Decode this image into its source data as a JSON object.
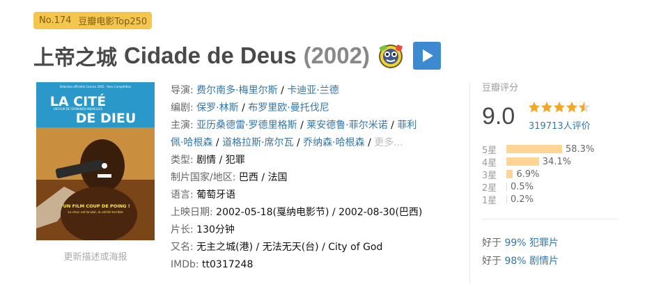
{
  "rank_badge": {
    "number": "No.174",
    "list": "豆瓣电影Top250"
  },
  "title": {
    "chinese": "上帝之城",
    "original": "Cidade de Deus",
    "year": "(2002)"
  },
  "icons": {
    "badge": "ticket-coin-icon",
    "play": "play-icon"
  },
  "poster": {
    "update_link": "更新描述或海报",
    "top_text": "Sélection officielle Cannes 2002 · Hors Compétition",
    "title_line1": "LA CITÉ",
    "title_line2": "DE DIEU",
    "director_line": "UN FILM DE FERNANDO MEIRELLES",
    "bottom_line1": "\"UN FILM COUP DE POING !",
    "bottom_line2": "Le choc est brutal, la vérité terrible"
  },
  "info": {
    "director": {
      "label": "导演:",
      "values": [
        "费尔南多·梅里尔斯",
        "卡迪亚·兰德"
      ]
    },
    "writer": {
      "label": "编剧:",
      "values": [
        "保罗·林斯",
        "布罗里欧·曼托伐尼"
      ]
    },
    "cast": {
      "label": "主演:",
      "line1": [
        "亚历桑德雷·罗德里格斯",
        "莱安德鲁·菲尔米诺",
        "菲利"
      ],
      "line2": [
        "佩·哈根森",
        "道格拉斯·席尔瓦",
        "乔纳森·哈根森"
      ],
      "more": "更多..."
    },
    "genre": {
      "label": "类型:",
      "values": [
        "剧情",
        "犯罪"
      ]
    },
    "region": {
      "label": "制片国家/地区:",
      "value": "巴西 / 法国"
    },
    "language": {
      "label": "语言:",
      "value": "葡萄牙语"
    },
    "release": {
      "label": "上映日期:",
      "values": [
        "2002-05-18(戛纳电影节)",
        "2002-08-30(巴西)"
      ]
    },
    "runtime": {
      "label": "片长:",
      "value": "130分钟"
    },
    "aka": {
      "label": "又名:",
      "value": "无主之城(港) / 无法无天(台) / City of God"
    },
    "imdb": {
      "label": "IMDb:",
      "value": "tt0317248"
    }
  },
  "rating": {
    "label": "豆瓣评分",
    "score": "9.0",
    "stars": 4.5,
    "votes": "319713人评价",
    "distribution": [
      {
        "star": "5星",
        "percent": "58.3%",
        "value": 58.3
      },
      {
        "star": "4星",
        "percent": "34.1%",
        "value": 34.1
      },
      {
        "star": "3星",
        "percent": "6.9%",
        "value": 6.9
      },
      {
        "star": "2星",
        "percent": "0.5%",
        "value": 0.5
      },
      {
        "star": "1星",
        "percent": "0.2%",
        "value": 0.2
      }
    ],
    "better_than": [
      {
        "prefix": "好于",
        "percent": "99%",
        "genre": "犯罪片"
      },
      {
        "prefix": "好于",
        "percent": "98%",
        "genre": "剧情片"
      }
    ]
  },
  "colors": {
    "link": "#3377aa",
    "badge": "#f5c64d",
    "bar": "#ffd596",
    "star": "#f5a623",
    "play": "#3d8ad0"
  }
}
